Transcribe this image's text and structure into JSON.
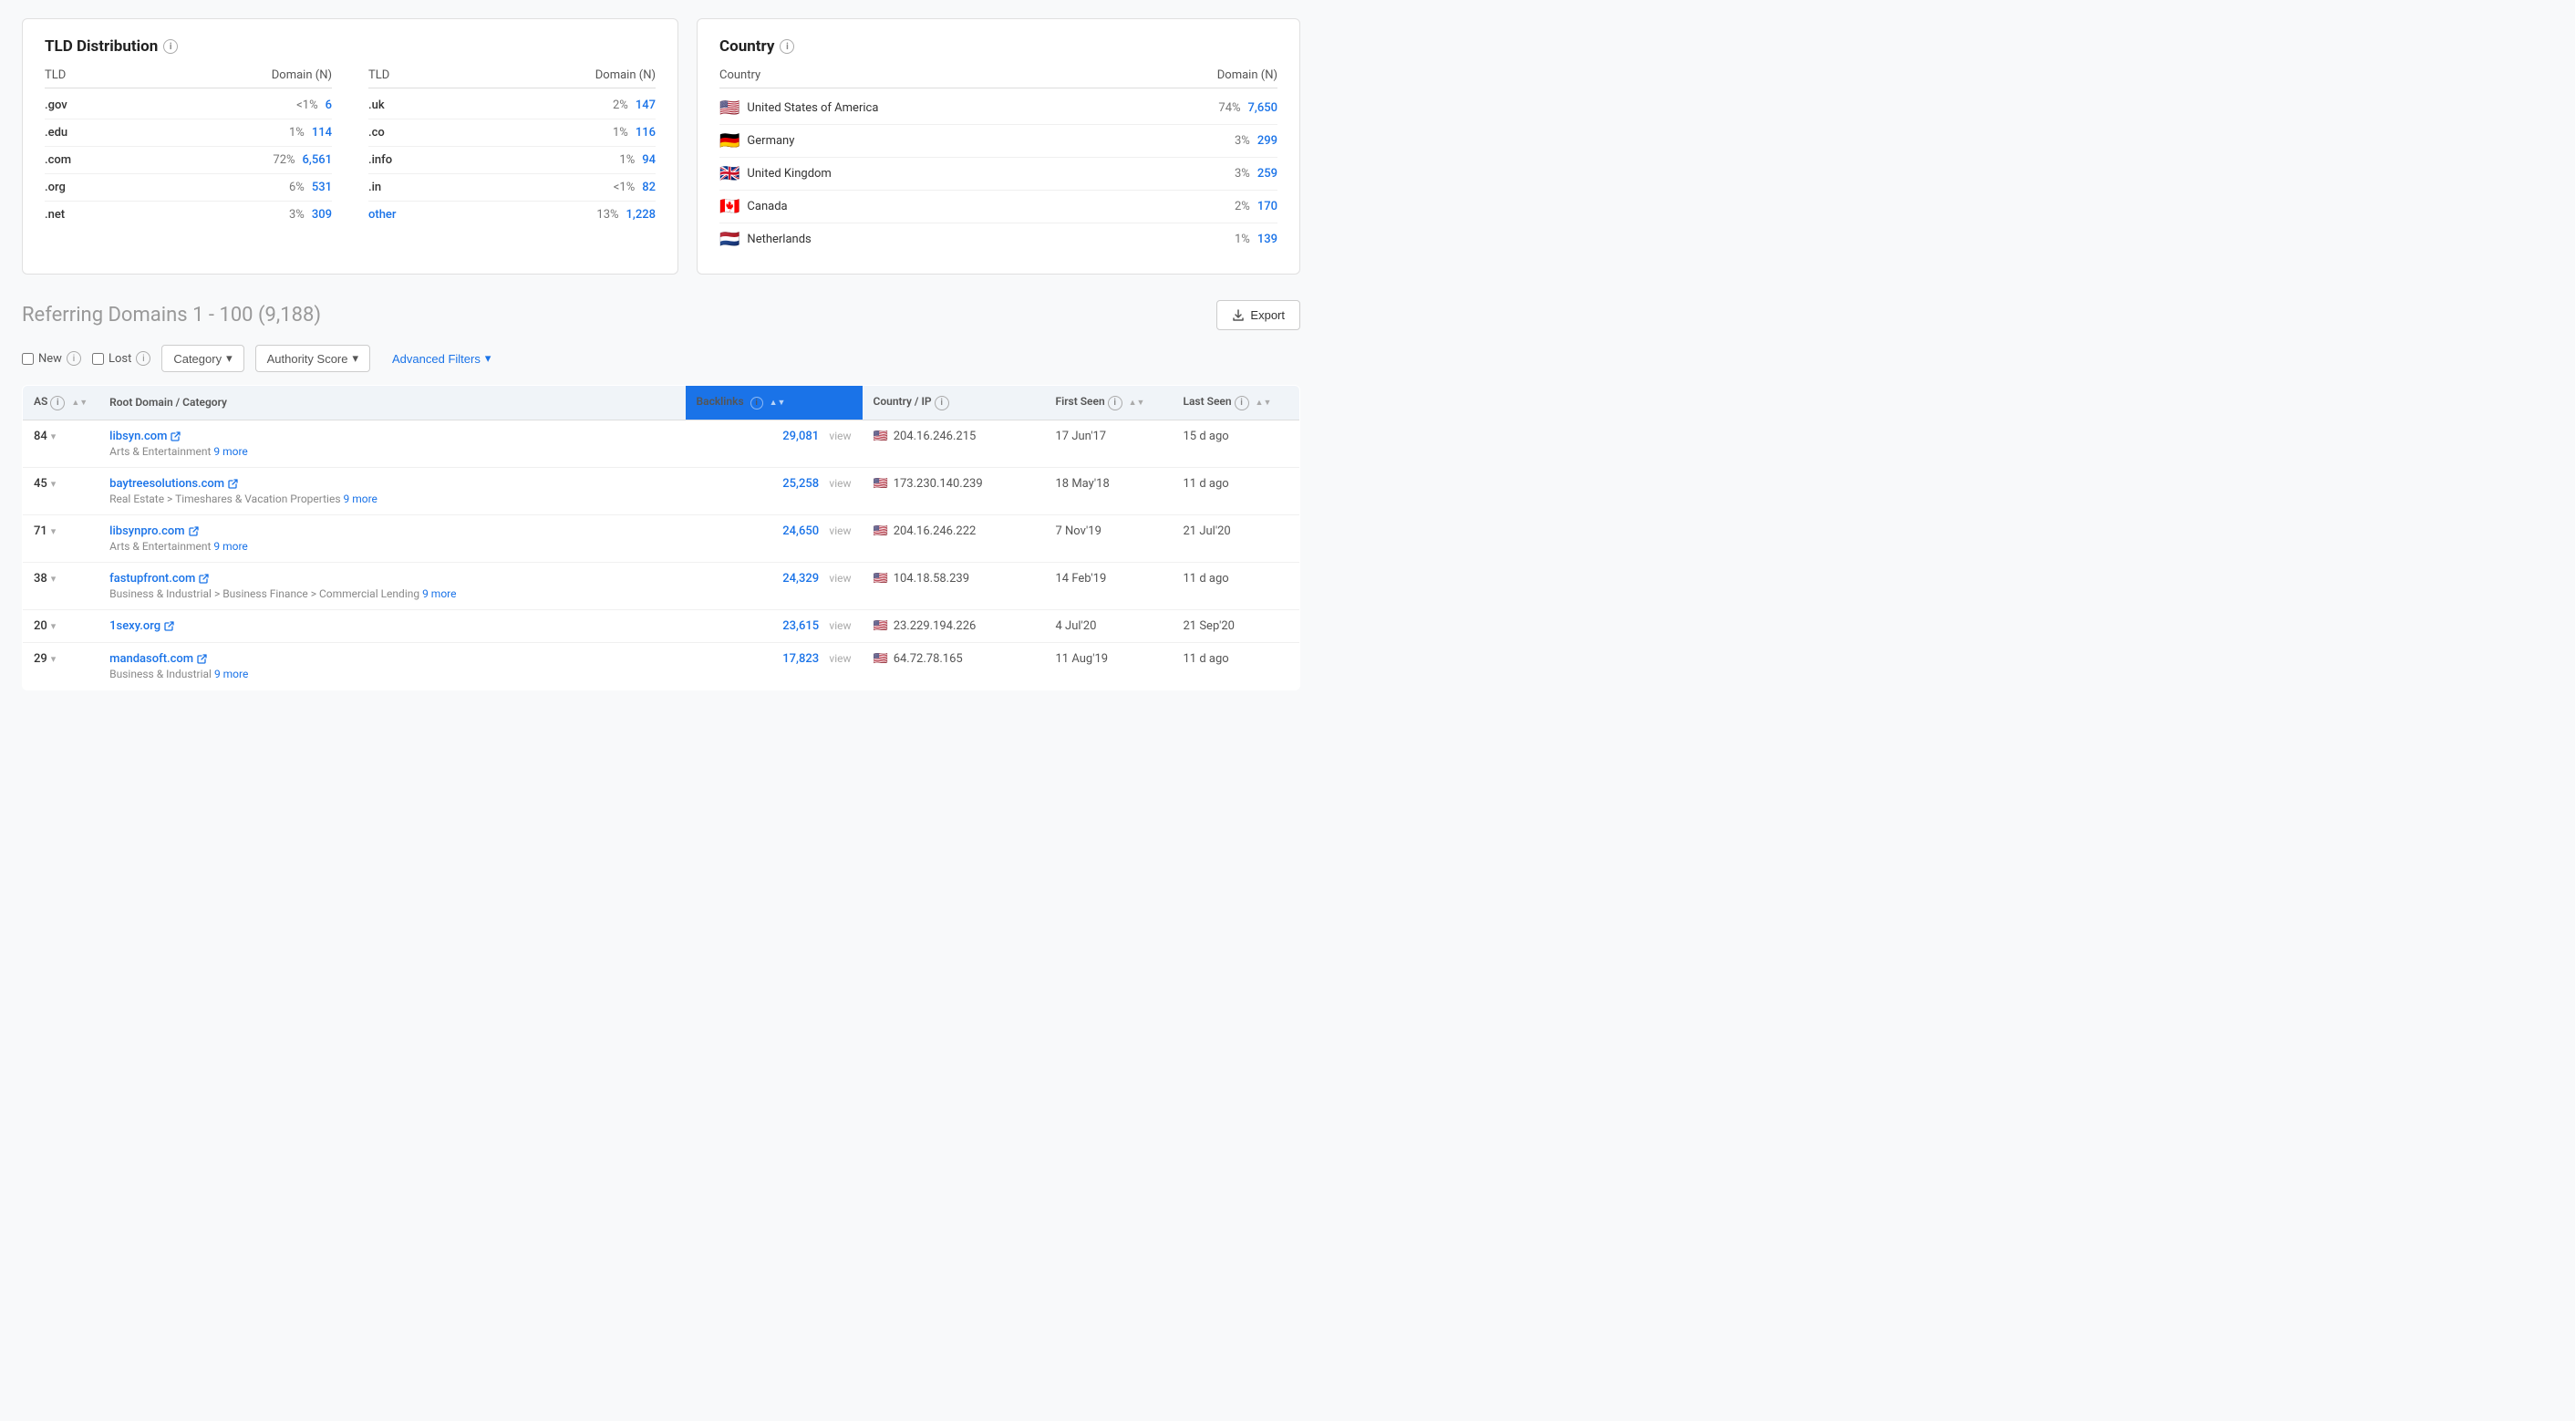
{
  "tld_section": {
    "title": "TLD Distribution",
    "col1_headers": [
      "TLD",
      "Domain (N)"
    ],
    "col2_headers": [
      "TLD",
      "Domain (N)"
    ],
    "col1_rows": [
      {
        "tld": ".gov",
        "pct": "<1%",
        "count": "6"
      },
      {
        "tld": ".edu",
        "pct": "1%",
        "count": "114"
      },
      {
        "tld": ".com",
        "pct": "72%",
        "count": "6,561"
      },
      {
        "tld": ".org",
        "pct": "6%",
        "count": "531"
      },
      {
        "tld": ".net",
        "pct": "3%",
        "count": "309"
      }
    ],
    "col2_rows": [
      {
        "tld": ".uk",
        "pct": "2%",
        "count": "147"
      },
      {
        "tld": ".co",
        "pct": "1%",
        "count": "116"
      },
      {
        "tld": ".info",
        "pct": "1%",
        "count": "94"
      },
      {
        "tld": ".in",
        "pct": "<1%",
        "count": "82"
      },
      {
        "tld": "other",
        "pct": "13%",
        "count": "1,228",
        "is_other": true
      }
    ]
  },
  "country_section": {
    "title": "Country",
    "headers": [
      "Country",
      "Domain (N)"
    ],
    "rows": [
      {
        "flag": "🇺🇸",
        "name": "United States of America",
        "pct": "74%",
        "count": "7,650"
      },
      {
        "flag": "🇩🇪",
        "name": "Germany",
        "pct": "3%",
        "count": "299"
      },
      {
        "flag": "🇬🇧",
        "name": "United Kingdom",
        "pct": "3%",
        "count": "259"
      },
      {
        "flag": "🇨🇦",
        "name": "Canada",
        "pct": "2%",
        "count": "170"
      },
      {
        "flag": "🇳🇱",
        "name": "Netherlands",
        "pct": "1%",
        "count": "139"
      }
    ]
  },
  "referring_domains": {
    "title": "Referring Domains",
    "range": "1 - 100 (9,188)",
    "export_label": "Export",
    "filters": {
      "new_label": "New",
      "lost_label": "Lost",
      "category_label": "Category",
      "authority_score_label": "Authority Score",
      "advanced_filters_label": "Advanced Filters"
    },
    "table": {
      "headers": {
        "as": "AS",
        "root_domain": "Root Domain / Category",
        "backlinks": "Backlinks",
        "country_ip": "Country / IP",
        "first_seen": "First Seen",
        "last_seen": "Last Seen"
      },
      "rows": [
        {
          "as": "84",
          "domain": "libsyn.com",
          "category": "Arts & Entertainment",
          "more": "9 more",
          "backlinks": "29,081",
          "flag": "🇺🇸",
          "ip": "204.16.246.215",
          "first_seen": "17 Jun'17",
          "last_seen": "15 d ago"
        },
        {
          "as": "45",
          "domain": "baytreesolutions.com",
          "category": "Real Estate > Timeshares & Vacation Properties",
          "more": "9 more",
          "backlinks": "25,258",
          "flag": "🇺🇸",
          "ip": "173.230.140.239",
          "first_seen": "18 May'18",
          "last_seen": "11 d ago"
        },
        {
          "as": "71",
          "domain": "libsynpro.com",
          "category": "Arts & Entertainment",
          "more": "9 more",
          "backlinks": "24,650",
          "flag": "🇺🇸",
          "ip": "204.16.246.222",
          "first_seen": "7 Nov'19",
          "last_seen": "21 Jul'20"
        },
        {
          "as": "38",
          "domain": "fastupfront.com",
          "category": "Business & Industrial > Business Finance > Commercial Lending",
          "more": "9 more",
          "backlinks": "24,329",
          "flag": "🇺🇸",
          "ip": "104.18.58.239",
          "first_seen": "14 Feb'19",
          "last_seen": "11 d ago"
        },
        {
          "as": "20",
          "domain": "1sexy.org",
          "category": "",
          "more": "",
          "backlinks": "23,615",
          "flag": "🇺🇸",
          "ip": "23.229.194.226",
          "first_seen": "4 Jul'20",
          "last_seen": "21 Sep'20"
        },
        {
          "as": "29",
          "domain": "mandasoft.com",
          "category": "Business & Industrial",
          "more": "9 more",
          "backlinks": "17,823",
          "flag": "🇺🇸",
          "ip": "64.72.78.165",
          "first_seen": "11 Aug'19",
          "last_seen": "11 d ago"
        }
      ]
    }
  }
}
